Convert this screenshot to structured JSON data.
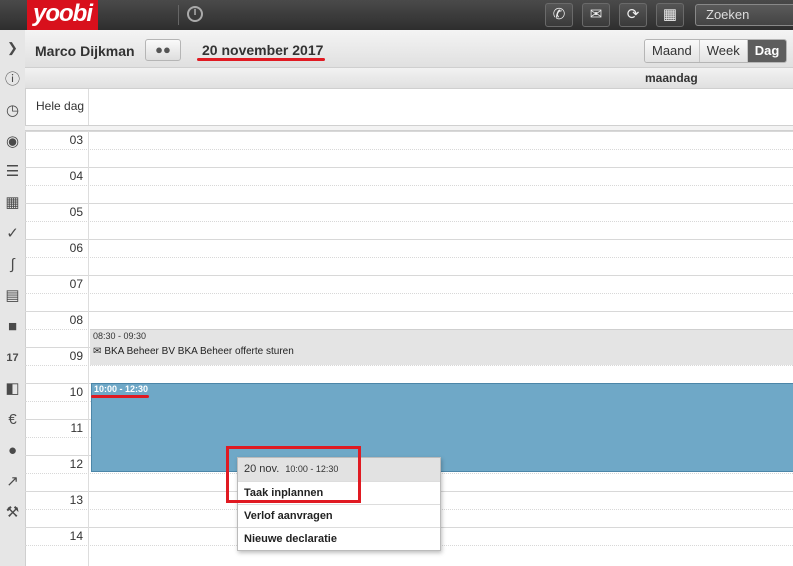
{
  "topbar": {
    "logo": "yoobi",
    "search_placeholder": "Zoeken",
    "buttons": [
      "phone-icon",
      "mail-icon",
      "refresh-icon",
      "contacts-icon"
    ]
  },
  "sidebar": {
    "items": [
      "expand-icon",
      "info-icon",
      "clock-icon",
      "piggybank-icon",
      "coins-icon",
      "calendar-icon",
      "clipboard-icon",
      "paperclip-icon",
      "archive-icon",
      "box-icon",
      "calendar-17-icon",
      "addressbook-icon",
      "moneybag-icon",
      "users-icon",
      "chart-icon",
      "wrench-icon"
    ]
  },
  "header": {
    "user_name": "Marco Dijkman",
    "date_title": "20 november 2017",
    "views": [
      "Maand",
      "Week",
      "Dag"
    ],
    "active_view": "Dag"
  },
  "day": {
    "day_name": "maandag",
    "allday_label": "Hele dag"
  },
  "hours": [
    "03",
    "04",
    "05",
    "06",
    "07",
    "08",
    "09",
    "10",
    "11",
    "12",
    "13",
    "14"
  ],
  "events": [
    {
      "time": "08:30 - 09:30",
      "title": "BKA Beheer BV BKA Beheer offerte sturen"
    },
    {
      "time": "10:00 - 12:30"
    }
  ],
  "context_menu": {
    "date": "20 nov.",
    "time": "10:00 - 12:30",
    "items": [
      "Taak inplannen",
      "Verlof aanvragen",
      "Nieuwe declaratie"
    ]
  },
  "colors": {
    "brand_red": "#d8101c",
    "event_blue": "#6fa8c7",
    "annotation_red": "#e01a22"
  }
}
